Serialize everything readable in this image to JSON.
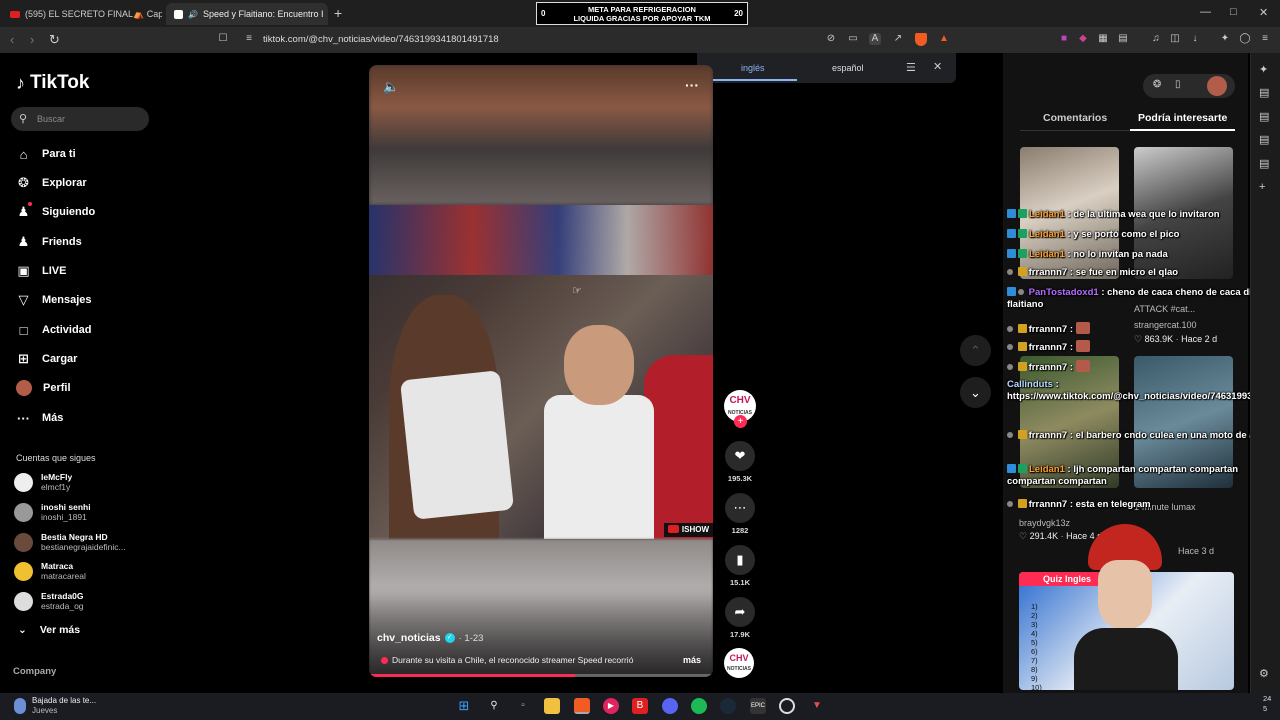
{
  "browser": {
    "tabs": [
      {
        "label": "(595) EL SECRETO FINAL⛺ Capitulo",
        "icon": "youtube-icon"
      },
      {
        "label": "Speed y Flaitiano: Encuentro I",
        "icon": "tiktok-icon",
        "close": "✕"
      }
    ],
    "new_tab": "+",
    "url": "tiktok.com/@chv_noticias/video/7463199341801491718",
    "banner": {
      "line1": "META PARA REFRIGERACION",
      "line2": "LIQUIDA GRACIAS POR APOYAR TKM",
      "left": "0",
      "right": "20"
    },
    "window_controls": [
      "—",
      "□",
      "✕"
    ]
  },
  "translate": {
    "lang1": "inglés",
    "lang2": "español",
    "menu": "☰",
    "close": "✕"
  },
  "sidebar": {
    "logo": "TikTok",
    "search_placeholder": "Buscar",
    "nav": [
      {
        "label": "Para ti",
        "icon": "home-icon"
      },
      {
        "label": "Explorar",
        "icon": "compass-icon"
      },
      {
        "label": "Siguiendo",
        "icon": "following-icon"
      },
      {
        "label": "Friends",
        "icon": "friends-icon"
      },
      {
        "label": "LIVE",
        "icon": "live-icon"
      },
      {
        "label": "Mensajes",
        "icon": "messages-icon"
      },
      {
        "label": "Actividad",
        "icon": "activity-icon"
      },
      {
        "label": "Cargar",
        "icon": "upload-icon"
      },
      {
        "label": "Perfil",
        "icon": "profile-avatar"
      },
      {
        "label": "Más",
        "icon": "more-icon"
      }
    ],
    "following_title": "Cuentas que sigues",
    "following": [
      {
        "name": "IeMcFly",
        "user": "elmcf1y"
      },
      {
        "name": "inoshi senhi",
        "user": "inoshi_1891"
      },
      {
        "name": "Bestia Negra HD",
        "user": "bestianegrajaidefinic..."
      },
      {
        "name": "Matraca",
        "user": "matracareal"
      },
      {
        "name": "Estrada0G",
        "user": "estrada_og"
      }
    ],
    "see_more": "Ver más",
    "company": "Company"
  },
  "video": {
    "author": "chv_noticias",
    "date": "· 1-23",
    "description": "Durante su visita a Chile, el reconocido streamer Speed recorrió",
    "more": "más",
    "watermark": "ISHOW",
    "progress": 0.6
  },
  "actions": {
    "channel_logo": "CHV",
    "channel_sub": "NOTICIAS",
    "likes": "195.3K",
    "comments": "1282",
    "saves": "15.1K",
    "shares": "17.9K"
  },
  "right_panel": {
    "tab_comments": "Comentarios",
    "tab_suggested": "Podría interesarte",
    "suggested": [
      {
        "title": "ATTACK #cat...",
        "user": "strangercat.100",
        "likes": "863.9K",
        "age": "Hace 2 d"
      },
      {
        "user": "braydvgk13z",
        "likes": "291.4K",
        "age": "Hace 4 d"
      },
      {
        "title": "1-minute lumax",
        "age": "Hace 3 d"
      }
    ],
    "quiz_label": "Quiz Ingles",
    "quiz_numbers": "1)\n2)\n3)\n4)\n5)\n6)\n7)\n8)\n9)\n10)"
  },
  "chat": [
    {
      "user": "Leidan1",
      "msg": ": de la ultima wea que lo invitaron",
      "style": "orange"
    },
    {
      "user": "Leidan1",
      "msg": ": y se portó como el pico",
      "style": "orange"
    },
    {
      "user": "Leidan1",
      "msg": ": no lo invitan pa nada",
      "style": "orange"
    },
    {
      "user": "frrannn7",
      "msg": ": se fue en micro el qlao",
      "style": "white"
    },
    {
      "user": "PanTostadoxd1",
      "msg": ": cheno de caca cheno de caca dijo el flaitiano",
      "style": "purple"
    },
    {
      "user": "frrannn7",
      "msg": ":",
      "style": "white"
    },
    {
      "user": "frrannn7",
      "msg": ":",
      "style": "white"
    },
    {
      "user": "frrannn7",
      "msg": ":",
      "style": "white"
    },
    {
      "user": "Callinduts",
      "msg": ": https://www.tiktok.com/@chv_noticias/video/7463199341801491718",
      "style": "cyan"
    },
    {
      "user": "frrannn7",
      "msg": ": el barbero cndo culea en una moto de agua",
      "style": "white"
    },
    {
      "user": "Leidan1",
      "msg": ": ljh compartan compartan compartan compartan compartan",
      "style": "orange"
    },
    {
      "user": "frrannn7",
      "msg": ": esta en telegram",
      "style": "white"
    }
  ],
  "taskbar": {
    "weather_title": "Bajada de las te...",
    "weather_sub": "Jueves",
    "clock_top": "24",
    "clock_bottom": "5"
  },
  "colors": {
    "accent": "#fe2c55",
    "verified": "#20d5ec",
    "translate_blue": "#8ab4f8"
  }
}
